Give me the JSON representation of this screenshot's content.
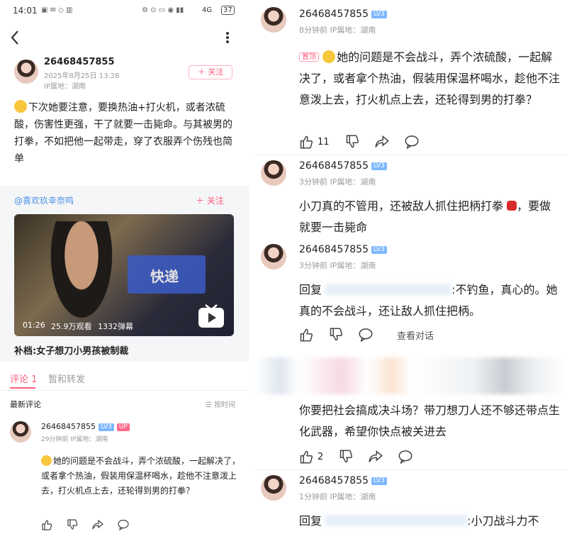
{
  "status_bar": {
    "time": "14:01",
    "network": "4G",
    "battery": "37"
  },
  "post": {
    "username": "26468457855",
    "timestamp": "2025年8月25日 13:28",
    "ip": "IP属地：湖南",
    "follow_label": "＋ 关注",
    "text": "下次她要注意，要换热油+打火机，或者浓硫酸，伤害性更强，干了就要一击毙命。与其被男的打拳，不如把他一起带走，穿了衣服弄个伤残也简单",
    "repost_author": "@喜欢玖幸奈鸣",
    "repost_follow_label": "＋ 关注",
    "video": {
      "overlay_text": "快递",
      "duration": "01:26",
      "views": "25.9万观看",
      "danmaku": "1332弹幕"
    },
    "video_title": "补档:女子想刀小男孩被制裁"
  },
  "tabs": {
    "comments": "评论 1",
    "reposts": "暂和转发"
  },
  "sort": {
    "latest": "最新评论",
    "order": "按时间"
  },
  "left_comment": {
    "username": "26468457855",
    "lv": "LV3",
    "up": "UP",
    "meta": "29分钟前 IP属地：湖南",
    "text": "她的问题是不会战斗，弄个浓硫酸，一起解决了，或者拿个热油，假装用保温杯喝水，趁他不注意泼上去，打火机点上去，还轮得到男的打拳？"
  },
  "right": {
    "c1": {
      "username": "26468457855",
      "lv": "LV3",
      "meta": "8分钟前 IP属地：湖南",
      "tag": "置顶",
      "text": "她的问题是不会战斗，弄个浓硫酸，一起解决了，或者拿个热油，假装用保温杯喝水，趁他不注意泼上去，打火机点上去，还轮得到男的打拳？",
      "likes": "11"
    },
    "c2": {
      "username": "26468457855",
      "lv": "LV3",
      "meta": "3分钟前 IP属地：湖南",
      "text": "小刀真的不管用，还被敌人抓住把柄打拳",
      "text2": "，要做就要一击毙命"
    },
    "c3": {
      "username": "26468457855",
      "lv": "LV3",
      "meta": "3分钟前 IP属地：湖南",
      "reply_prefix": "回复",
      "text": ":不钓鱼，真心的。她真的不会战斗，还让敌人抓住把柄。",
      "view_chat": "查看对话"
    },
    "c4": {
      "text": "你要把社会搞成决斗场？带刀想刀人还不够还带点生化武器，希望你快点被关进去",
      "likes": "2"
    },
    "c5": {
      "username": "26468457855",
      "lv": "LV3",
      "meta": "1分钟前 IP属地：湖南",
      "reply_prefix": "回复",
      "text": ":小刀战斗力不"
    }
  },
  "colors": {
    "accent": "#ff5c7c",
    "lv_blue": "#7db8ff",
    "link_blue": "#4a90e2"
  }
}
